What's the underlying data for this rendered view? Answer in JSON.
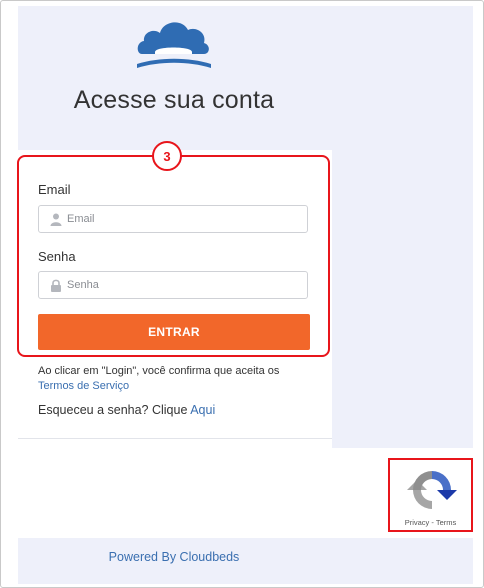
{
  "page": {
    "title": "Acesse sua conta",
    "step_number": "3"
  },
  "form": {
    "email_label": "Email",
    "email_placeholder": "Email",
    "password_label": "Senha",
    "password_placeholder": "Senha",
    "submit_label": "ENTRAR"
  },
  "legal": {
    "text": "Ao clicar em \"Login\", você confirma que aceita os",
    "terms_link": "Termos de Serviço"
  },
  "forgot": {
    "text": "Esqueceu a senha? Clique ",
    "link": "Aqui"
  },
  "footer": {
    "powered_by": "Powered By Cloudbeds"
  },
  "recaptcha": {
    "links": "Privacy - Terms",
    "icon": "recaptcha-icon"
  },
  "colors": {
    "brand_blue": "#2f6cb3",
    "accent_orange": "#f2672a",
    "annotation_red": "#e8151b",
    "link_blue": "#3a6fb0"
  }
}
